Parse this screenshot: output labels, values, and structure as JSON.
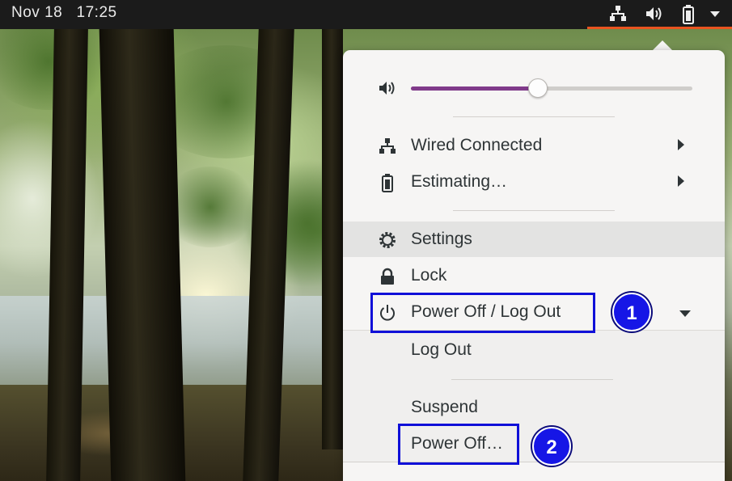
{
  "topbar": {
    "date": "Nov 18",
    "time": "17:25",
    "tray_icons": [
      "network-wired-icon",
      "volume-icon",
      "battery-icon",
      "menu-arrow-icon"
    ],
    "accent_color": "#e95420"
  },
  "menu": {
    "volume": {
      "icon": "volume-icon",
      "level": 0.45
    },
    "items": {
      "network": {
        "label": "Wired Connected",
        "icon": "network-wired-icon"
      },
      "battery": {
        "label": "Estimating…",
        "icon": "battery-icon"
      },
      "settings": {
        "label": "Settings",
        "icon": "gear-icon"
      },
      "lock": {
        "label": "Lock",
        "icon": "lock-icon"
      },
      "power": {
        "label": "Power Off / Log Out",
        "icon": "power-icon",
        "expanded": true
      },
      "logout": {
        "label": "Log Out"
      },
      "suspend": {
        "label": "Suspend"
      },
      "poweroff": {
        "label": "Power Off…"
      }
    }
  },
  "annotations": {
    "badge1": "1",
    "badge2": "2",
    "highlight_color": "#1010d8"
  }
}
